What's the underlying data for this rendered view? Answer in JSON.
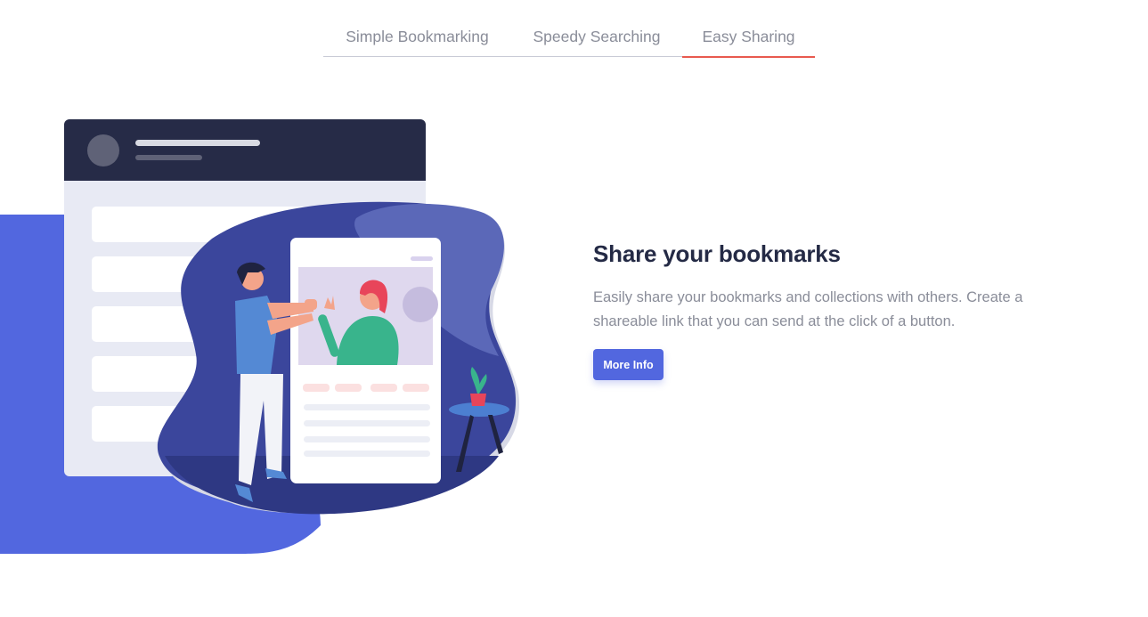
{
  "tabs": [
    {
      "label": "Simple Bookmarking",
      "active": false
    },
    {
      "label": "Speedy Searching",
      "active": false
    },
    {
      "label": "Easy Sharing",
      "active": true
    }
  ],
  "feature": {
    "title": "Share your bookmarks",
    "description": "Easily share your bookmarks and collections with others. Create a shareable link that you can send at the click of a button.",
    "button_label": "More Info"
  },
  "colors": {
    "accent": "#5267df",
    "tab_active_underline": "#e85a4f",
    "heading": "#242a45",
    "body_text": "#8a8d99"
  },
  "icons": {
    "illustration": "sharing-illustration"
  }
}
